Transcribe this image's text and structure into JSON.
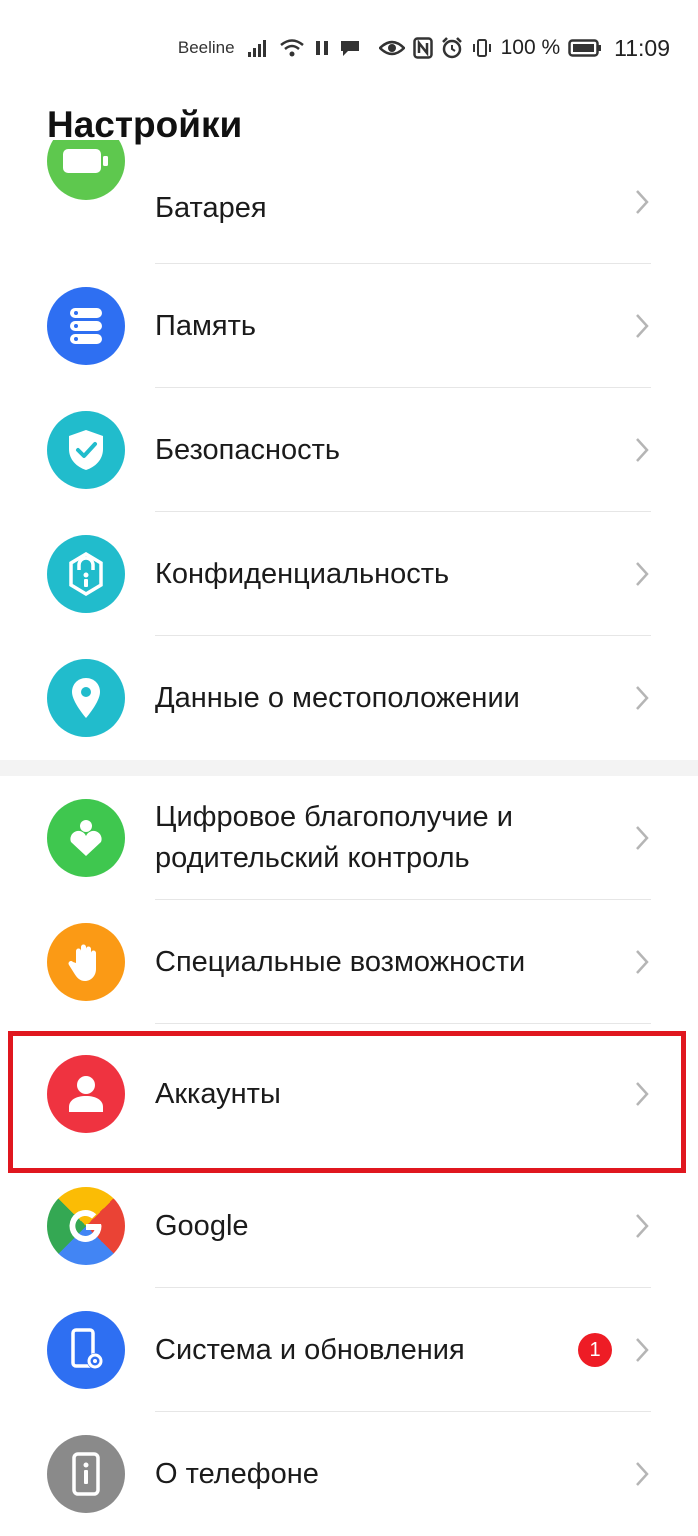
{
  "status_bar": {
    "carrier": "Beeline",
    "battery_percent": "100 %",
    "time": "11:09"
  },
  "header": {
    "title": "Настройки"
  },
  "settings": {
    "group1": [
      {
        "label": "Батарея",
        "icon": "battery-icon",
        "color": "#5ec84e"
      },
      {
        "label": "Память",
        "icon": "storage-icon",
        "color": "#2e6ff2"
      },
      {
        "label": "Безопасность",
        "icon": "shield-check-icon",
        "color": "#21bccc"
      },
      {
        "label": "Конфиденциальность",
        "icon": "privacy-lock-icon",
        "color": "#21bccc"
      },
      {
        "label": "Данные о местоположении",
        "icon": "location-pin-icon",
        "color": "#21bccc"
      }
    ],
    "group2": [
      {
        "label": "Цифровое благополучие и родительский контроль",
        "icon": "digital-wellbeing-icon",
        "color": "#3fc74f"
      },
      {
        "label": "Специальные возможности",
        "icon": "hand-icon",
        "color": "#fb9a15"
      },
      {
        "label": "Аккаунты",
        "icon": "user-icon",
        "color": "#ef3340"
      },
      {
        "label": "Google",
        "icon": "google-icon",
        "color": "#4285f4"
      },
      {
        "label": "Система и обновления",
        "icon": "system-update-icon",
        "color": "#2e6ff2",
        "badge": "1"
      },
      {
        "label": "О телефоне",
        "icon": "phone-info-icon",
        "color": "#8a8a8a"
      }
    ]
  }
}
